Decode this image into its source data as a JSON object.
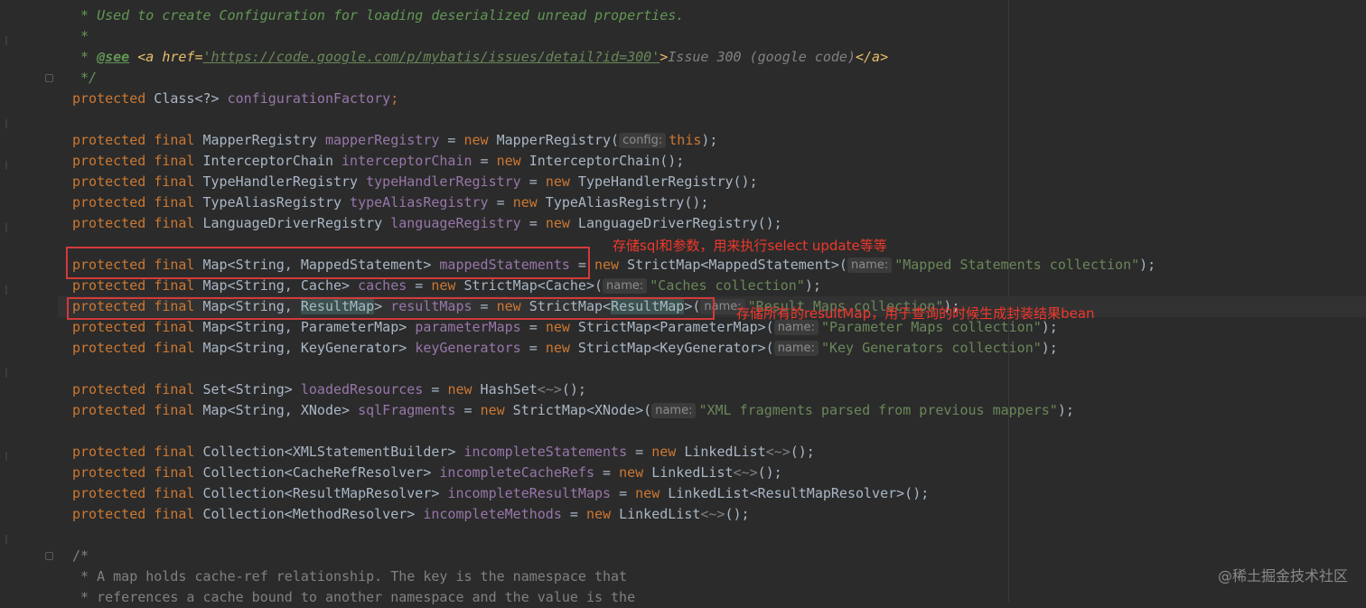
{
  "comment": {
    "l1": " * Used to create Configuration for loading deserialized unread properties.",
    "l2": " *",
    "l3_pre": " * ",
    "l3_see": "@see",
    "l3_open_tag": " <a href=",
    "l3_url": "'https://code.google.com/p/mybatis/issues/detail?id=300'",
    "l3_gt": ">",
    "l3_text": "Issue 300 (google code)",
    "l3_close": "</a>",
    "l4": " */"
  },
  "kw": {
    "protected": "protected",
    "final": "final",
    "new": "new",
    "this": "this"
  },
  "code": {
    "cf_type": " Class<?> ",
    "cf_name": "configurationFactory",
    "semi": ";",
    "mr_type": " MapperRegistry ",
    "mr_name": "mapperRegistry",
    "mr_ctor": " MapperRegistry(",
    "hint_config": "config:",
    "close_semi": ");",
    "ic_type": " InterceptorChain ",
    "ic_name": "interceptorChain",
    "ic_ctor": " InterceptorChain();",
    "th_type": " TypeHandlerRegistry ",
    "th_name": "typeHandlerRegistry",
    "th_ctor": " TypeHandlerRegistry();",
    "ta_type": " TypeAliasRegistry ",
    "ta_name": "typeAliasRegistry",
    "ta_ctor": " TypeAliasRegistry();",
    "ld_type": " LanguageDriverRegistry ",
    "ld_name": "languageRegistry",
    "ld_ctor": " LanguageDriverRegistry();",
    "eq": " = ",
    "hint_name": "name:",
    "ms_type": " Map<String, MappedStatement> ",
    "ms_name": "mappedStatements",
    "ms_ctor": " StrictMap<MappedStatement>(",
    "ms_str": "\"Mapped Statements collection\"",
    "c_type": " Map<String, Cache> ",
    "c_name": "caches",
    "c_ctor": " StrictMap<Cache>(",
    "c_str": "\"Caches collection\"",
    "rm_type_a": " Map<String, ",
    "rm_type_hl": "ResultMap",
    "rm_type_b": "> ",
    "rm_name": "resultMaps",
    "rm_ctor_a": " StrictMap<",
    "rm_ctor_b": ">(",
    "rm_str": "\"Result Maps collection\"",
    "pm_type": " Map<String, ParameterMap> ",
    "pm_name": "parameterMaps",
    "pm_ctor": " StrictMap<ParameterMap>(",
    "pm_str": "\"Parameter Maps collection\"",
    "kg_type": " Map<String, KeyGenerator> ",
    "kg_name": "keyGenerators",
    "kg_ctor": " StrictMap<KeyGenerator>(",
    "kg_str": "\"Key Generators collection\"",
    "lr_type": " Set<String> ",
    "lr_name": "loadedResources",
    "lr_ctor": " HashSet",
    "diamond": "<~>",
    "empty_close": "();",
    "sf_type": " Map<String, XNode> ",
    "sf_name": "sqlFragments",
    "sf_ctor": " StrictMap<XNode>(",
    "sf_str": "\"XML fragments parsed from previous mappers\"",
    "is_type": " Collection<XMLStatementBuilder> ",
    "is_name": "incompleteStatements",
    "is_ctor": " LinkedList",
    "icr_type": " Collection<CacheRefResolver> ",
    "icr_name": "incompleteCacheRefs",
    "icr_ctor": " LinkedList",
    "irm_type": " Collection<ResultMapResolver> ",
    "irm_name": "incompleteResultMaps",
    "irm_ctor": " LinkedList<ResultMapResolver>();",
    "im_type": " Collection<MethodResolver> ",
    "im_name": "incompleteMethods",
    "im_ctor": " LinkedList"
  },
  "comment2": {
    "l1": "/*",
    "l2": " * A map holds cache-ref relationship. The key is the namespace that",
    "l3": " * references a cache bound to another namespace and the value is the"
  },
  "annotations": {
    "mapped_statements_note": "存储sql和参数，用来执行select update等等",
    "result_maps_note": "存储所有的resultMap，用于查询的时候生成封装结果bean"
  },
  "watermark": "@稀土掘金技术社区",
  "colors": {
    "background": "#2b2b2b",
    "keyword": "#cc7832",
    "field": "#9876aa",
    "string": "#6a8759",
    "annotation_red": "#e03a3a"
  }
}
